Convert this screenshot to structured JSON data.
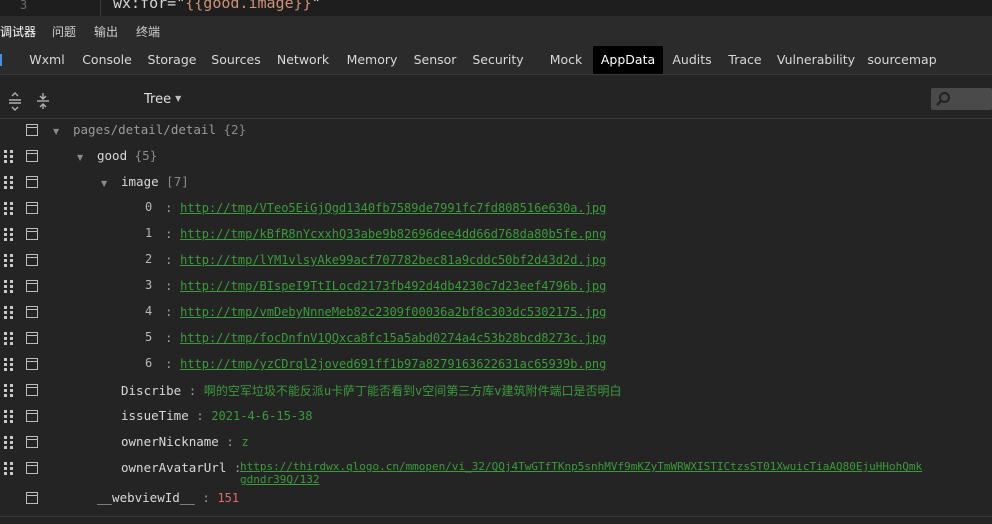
{
  "code_line": {
    "number": "3",
    "text_prefix": "wx:for=\"",
    "text_expr": "{{good.image}}",
    "text_suffix": "\""
  },
  "panel_tabs": [
    "调试器",
    "问题",
    "输出",
    "终端"
  ],
  "main_tabs": [
    "Wxml",
    "Console",
    "Storage",
    "Sources",
    "Network",
    "Memory",
    "Sensor",
    "Security",
    "Mock",
    "AppData",
    "Audits",
    "Trace",
    "Vulnerability",
    "sourcemap"
  ],
  "active_main_tab": "AppData",
  "toolbar": {
    "view_mode": "Tree",
    "search_placeholder": ""
  },
  "tree": {
    "root": {
      "label": "pages/detail/detail",
      "count": "{2}"
    },
    "good": {
      "label": "good",
      "count": "{5}"
    },
    "image": {
      "label": "image",
      "count": "[7]",
      "items": [
        {
          "index": "0",
          "value": "http://tmp/VTeo5EiGjQgd1340fb7589de7991fc7fd808516e630a.jpg"
        },
        {
          "index": "1",
          "value": "http://tmp/kBfR8nYcxxhQ33abe9b82696dee4dd66d768da80b5fe.png"
        },
        {
          "index": "2",
          "value": "http://tmp/lYM1vlsyAke99acf707782bec81a9cddc50bf2d43d2d.jpg"
        },
        {
          "index": "3",
          "value": "http://tmp/BIspeI9TtILocd2173fb492d4db4230c7d23eef4796b.jpg"
        },
        {
          "index": "4",
          "value": "http://tmp/vmDebyNnneMeb82c2309f00036a2bf8c303dc5302175.jpg"
        },
        {
          "index": "5",
          "value": "http://tmp/focDnfnV1QQxca8fc15a5abd0274a4c53b28bcd8273c.jpg"
        },
        {
          "index": "6",
          "value": "http://tmp/yzCDrql2joved691ff1b97a8279163622631ac65939b.png"
        }
      ]
    },
    "fields": [
      {
        "key": "Discribe",
        "value": "啊的空军垃圾不能反派u卡萨丁能否看到v空间第三方库v建筑附件端口是否明白",
        "kind": "str"
      },
      {
        "key": "issueTime",
        "value": "2021-4-6-15-38",
        "kind": "str"
      },
      {
        "key": "ownerNickname",
        "value": "z",
        "kind": "str"
      }
    ],
    "avatar": {
      "key": "ownerAvatarUrl",
      "value_line1": "https://thirdwx.qlogo.cn/mmopen/vi_32/QQj4TwGTfTKnp5snhMVf9mKZyTmWRWXISTICtzsST01XwuicTiaAQ80EjuHHohQmk",
      "value_line2": "gdndr39Q/132"
    },
    "webview": {
      "key": "__webviewId__",
      "value": "151"
    }
  },
  "colors": {
    "link_green": "#3c9a3c",
    "number_red": "#e06c6c",
    "active_tab_bg": "#000000",
    "background": "#242424"
  }
}
